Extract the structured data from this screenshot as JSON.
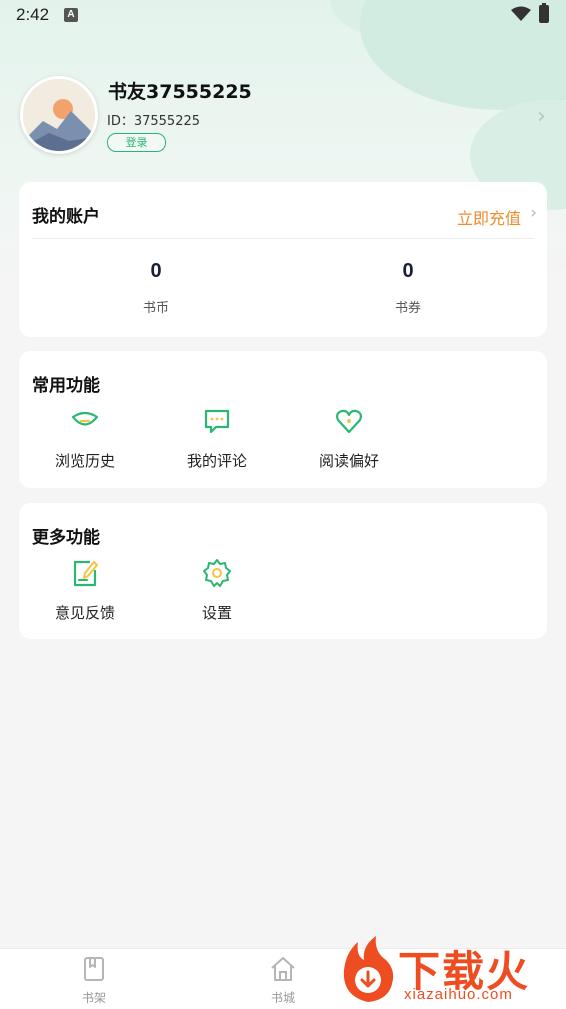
{
  "status_bar": {
    "time": "2:42",
    "notification_badge": "A"
  },
  "profile": {
    "name": "书友37555225",
    "id_line": "ID：37555225",
    "login_label": "登录"
  },
  "account": {
    "title": "我的账户",
    "recharge_label": "立即充值",
    "stats": [
      {
        "value": "0",
        "label": "书币"
      },
      {
        "value": "0",
        "label": "书券"
      }
    ]
  },
  "common": {
    "title": "常用功能",
    "items": [
      {
        "label": "浏览历史",
        "icon": "eye-icon"
      },
      {
        "label": "我的评论",
        "icon": "comment-icon"
      },
      {
        "label": "阅读偏好",
        "icon": "heart-icon"
      }
    ]
  },
  "more": {
    "title": "更多功能",
    "items": [
      {
        "label": "意见反馈",
        "icon": "feedback-edit-icon"
      },
      {
        "label": "设置",
        "icon": "gear-icon"
      }
    ]
  },
  "tabbar": {
    "items": [
      {
        "label": "书架",
        "icon": "bookshelf-icon"
      },
      {
        "label": "书城",
        "icon": "home-icon"
      }
    ]
  },
  "watermark": {
    "title": "下载火",
    "url": "xiazaihuo.com"
  },
  "colors": {
    "accent": "#2bb673",
    "recharge": "#f08b2e",
    "watermark": "#ee4d22"
  }
}
